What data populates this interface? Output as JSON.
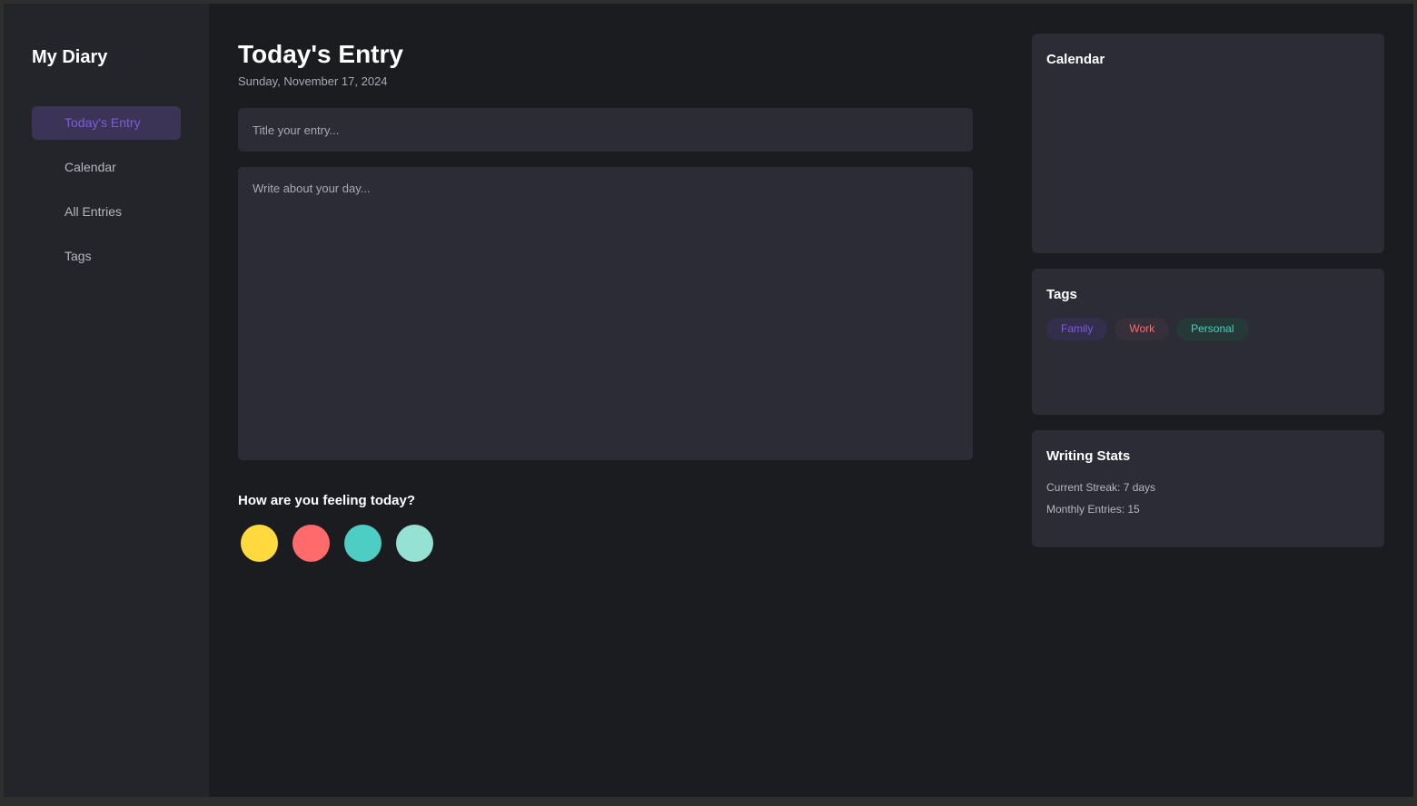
{
  "sidebar": {
    "app_title": "My Diary",
    "items": [
      {
        "label": "Today's Entry",
        "active": true
      },
      {
        "label": "Calendar",
        "active": false
      },
      {
        "label": "All Entries",
        "active": false
      },
      {
        "label": "Tags",
        "active": false
      }
    ]
  },
  "main": {
    "title": "Today's Entry",
    "date": "Sunday, November 17, 2024",
    "title_placeholder": "Title your entry...",
    "body_placeholder": "Write about your day...",
    "mood_prompt": "How are you feeling today?",
    "moods": [
      {
        "color": "#ffd93d"
      },
      {
        "color": "#ff6b6b"
      },
      {
        "color": "#4ecdc4"
      },
      {
        "color": "#95e1d3"
      }
    ]
  },
  "panels": {
    "calendar_title": "Calendar",
    "tags_title": "Tags",
    "tags": [
      "Family",
      "Work",
      "Personal"
    ],
    "stats_title": "Writing Stats",
    "current_streak": "Current Streak: 7 days",
    "monthly_entries": "Monthly Entries: 15"
  },
  "colors": {
    "accent": "#7c5cdb",
    "background": "#1b1c20",
    "sidebar": "#24252b",
    "card": "#2b2c35"
  }
}
